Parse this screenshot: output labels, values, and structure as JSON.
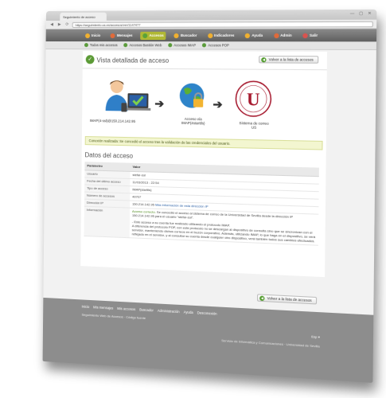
{
  "browser": {
    "tab_title": "Seguimiento de acceso",
    "window_buttons": "— ▢ ✕",
    "url": "https://seguimiento.us.es/accesos/ver/1147477",
    "nav_back": "◀",
    "nav_forward": "▶",
    "nav_reload": "⟳"
  },
  "topnav": {
    "items": [
      {
        "label": "Inicio",
        "color": "#f0b030"
      },
      {
        "label": "Mensajes",
        "color": "#e06a3a"
      },
      {
        "label": "Accesos",
        "color": "#5aa238",
        "active": true
      },
      {
        "label": "Buscador",
        "color": "#f0b030"
      },
      {
        "label": "Indicadores",
        "color": "#f0b030"
      },
      {
        "label": "Ayuda",
        "color": "#f0b030"
      },
      {
        "label": "Admin",
        "color": "#e06a3a"
      },
      {
        "label": "Salir",
        "color": "#d9534f"
      }
    ]
  },
  "subnav": {
    "items": [
      {
        "label": "Todos mis accesos"
      },
      {
        "label": "Accesos Bastión Web"
      },
      {
        "label": "Accesos IMAP"
      },
      {
        "label": "Accesos POP"
      }
    ]
  },
  "page": {
    "title": "Vista detallada de acceso",
    "back_label": "Volver a la lista de accesos",
    "back_arrow": "◀"
  },
  "flow": {
    "origin_caption": "IMAP(4-ssl)@150.214.142.95",
    "target_caption_line1": "Acceso vía",
    "target_caption_line2": "IMAP(4starttls)",
    "system_caption_line1": "Sistema de correo",
    "system_caption_line2": "US",
    "arrow": "➔"
  },
  "alert": "Conexión realizada: Se concedió el acceso tras la validación de las credenciales del usuario.",
  "details": {
    "heading": "Datos del acceso",
    "col_param": "Parámetro",
    "col_value": "Valor",
    "rows": [
      {
        "k": "Usuario",
        "v": "stefar-sol"
      },
      {
        "k": "Fecha del último acceso",
        "v": "11/03/2013 - 22:54"
      },
      {
        "k": "Tipo de acceso",
        "v": "IMAP(starttls)"
      },
      {
        "k": "Número de accesos",
        "v": "40707"
      },
      {
        "k": "Dirección IP",
        "v": "150.214.142.95",
        "link": "Más información de esta dirección IP"
      }
    ],
    "info_label": "Información",
    "info_ok": "Acceso correcto.",
    "info_line1": "Se concedió el acceso al sistema de correo de la Universidad de Sevilla desde la dirección IP 150.214.142.95 para el usuario \"stefar-sol\".",
    "info_line2": "- Este acceso a su cuenta fue realizado utilizando el protocolo IMAP.",
    "info_line3": "A diferencia del protocolo POP, con este protocolo no se descargan al dispositivo de consulta sino que se sincronizan con el servidor, manteniendo dichos correos en el buzón corporativo. Además, utilizando IMAP, lo que haga en el dispositivo, se verá reflejado en el servidor, y al consultar su cuenta desde cualquier otro dispositivo, verá también todos sus cambios efectuados."
  },
  "footer": {
    "links": [
      "Inicio",
      "Mis mensajes",
      "Mis accesos",
      "Buscador",
      "Administración",
      "Ayuda",
      "Desconexión"
    ],
    "copyright": "Seguimiento Web de Accesos · Código fuente",
    "lang": "Esp ▾",
    "institution": "Servicio de Informática y Comunicaciones · Universidad de Sevilla"
  },
  "colors": {
    "topnav_active": "#b0b834",
    "footer_bg": "#8d8d8d",
    "alert_bg": "#f3f6d0",
    "brand_red": "#a6192e"
  }
}
